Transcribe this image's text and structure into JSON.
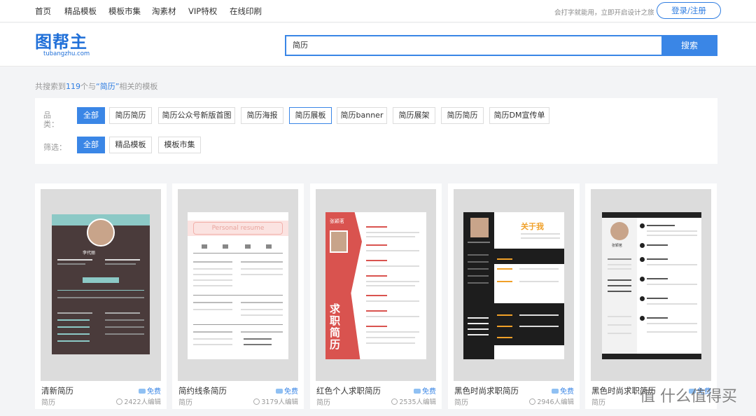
{
  "topnav": {
    "items": [
      "首页",
      "精品模板",
      "模板市集",
      "淘素材",
      "VIP特权",
      "在线印刷"
    ],
    "slogan": "会打字就能用，立即开启设计之旅",
    "login": "登录/注册"
  },
  "header": {
    "logo_text": "图帮主",
    "logo_sub": "tubangzhu.com",
    "search_value": "简历",
    "search_button": "搜索"
  },
  "results": {
    "prefix": "共搜索到",
    "count": "119",
    "middle": "个与",
    "keyword": "“简历”",
    "suffix": "相关的模板"
  },
  "filters": {
    "category_label": "品\n类：",
    "category_tags": [
      "全部",
      "简历简历",
      "简历公众号新版首图",
      "简历海报",
      "简历展板",
      "简历banner",
      "简历展架",
      "简历简历",
      "简历DM宣传单"
    ],
    "screen_label": "筛选：",
    "screen_tags": [
      "全部",
      "精品模板",
      "模板市集"
    ]
  },
  "cards": [
    {
      "title": "清新简历",
      "category": "简历",
      "free": "免费",
      "edits": "2422人编辑"
    },
    {
      "title": "简约线条简历",
      "category": "简历",
      "free": "免费",
      "edits": "3179人编辑"
    },
    {
      "title": "红色个人求职简历",
      "category": "简历",
      "free": "免费",
      "edits": "2535人编辑"
    },
    {
      "title": "黑色时尚求职简历",
      "category": "简历",
      "free": "免费",
      "edits": "2946人编辑"
    },
    {
      "title": "黑色时尚求职简历",
      "category": "简历",
      "free": "免费",
      "edits": ""
    }
  ],
  "thumbs": {
    "t1_name": "李代丽",
    "t2_heading": "Personal resume",
    "t3_name": "张颖茗",
    "t3_vertical": "求职简历",
    "t4_heading": "关于我",
    "t5_name": "张颖茗"
  },
  "watermark": "值 什么值得买",
  "colors": {
    "accent": "#3a86e6",
    "brand": "#1f6fd8",
    "resume_red": "#d9534f"
  }
}
